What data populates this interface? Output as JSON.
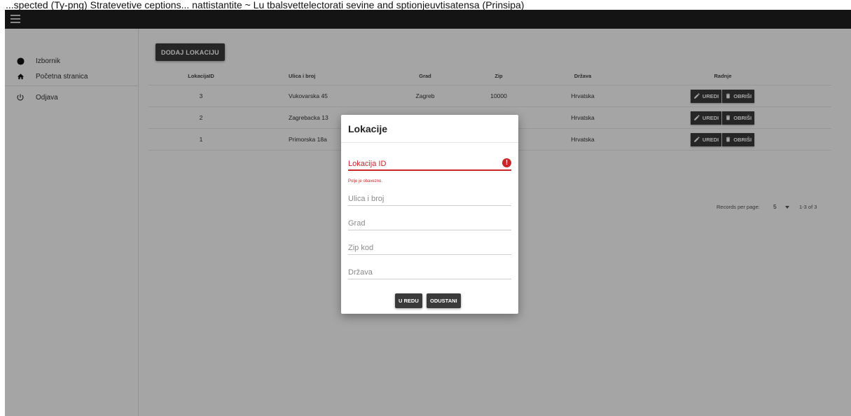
{
  "caption": "...spected (Ty-png) Stratevetive ceptions... nattistantite ~ Lu tbalsvettelectorati sevine and sptionjeuvtisatensa (Prinsipa)",
  "sidebar": {
    "items": [
      {
        "label": "Izbornik",
        "icon": "circle-icon"
      },
      {
        "label": "Početna stranica",
        "icon": "home-icon"
      },
      {
        "label": "Odjava",
        "icon": "power-icon"
      }
    ]
  },
  "toolbar": {
    "add_label": "DODAJ LOKACIJU"
  },
  "table": {
    "columns": [
      "LokacijaID",
      "Ulica i broj",
      "Grad",
      "Zip",
      "Država",
      "Radnje"
    ],
    "rows": [
      {
        "id": "3",
        "street": "Vukovarska 45",
        "city": "Zagreb",
        "zip": "10000",
        "country": "Hrvatska"
      },
      {
        "id": "2",
        "street": "Zagrebacka 13",
        "city": "",
        "zip": "",
        "country": "Hrvatska"
      },
      {
        "id": "1",
        "street": "Primorska 18a",
        "city": "",
        "zip": "",
        "country": "Hrvatska"
      }
    ],
    "edit_label": "UREDI",
    "delete_label": "OBRIŠI"
  },
  "pager": {
    "label": "Records per page:",
    "per_page": "5",
    "range": "1-3 of 3"
  },
  "dialog": {
    "title": "Lokacije",
    "fields": {
      "id": {
        "placeholder": "Lokacija ID",
        "value": ""
      },
      "street": {
        "placeholder": "Ulica i broj",
        "value": ""
      },
      "city": {
        "placeholder": "Grad",
        "value": ""
      },
      "zip": {
        "placeholder": "Zip kod",
        "value": ""
      },
      "country": {
        "placeholder": "Država",
        "value": ""
      }
    },
    "error": "Polje je obavezno.",
    "ok_label": "U REDU",
    "cancel_label": "ODUSTANI"
  },
  "colors": {
    "topbar": "#1f1f1f",
    "button": "#3a3a3a",
    "error": "#c62828"
  }
}
